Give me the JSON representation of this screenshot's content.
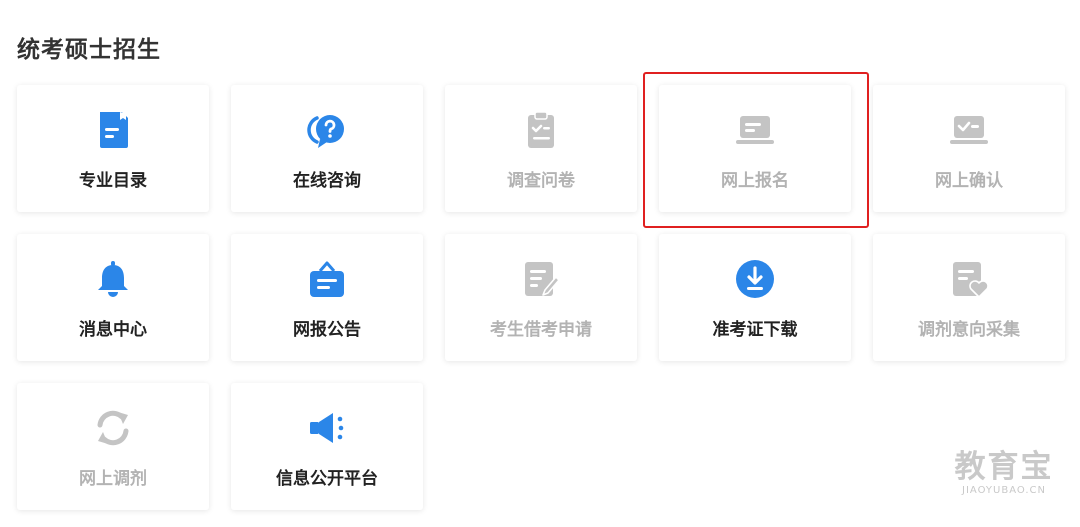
{
  "page": {
    "title": "统考硕士招生"
  },
  "colors": {
    "active": "#2b86e8",
    "disabled": "#c4c4c4",
    "highlight": "#e02020"
  },
  "cards": [
    {
      "label": "专业目录",
      "icon": "catalog-document-icon",
      "state": "active"
    },
    {
      "label": "在线咨询",
      "icon": "chat-question-icon",
      "state": "active"
    },
    {
      "label": "调查问卷",
      "icon": "clipboard-check-icon",
      "state": "disabled"
    },
    {
      "label": "网上报名",
      "icon": "laptop-icon",
      "state": "disabled",
      "highlighted": true
    },
    {
      "label": "网上确认",
      "icon": "laptop-check-icon",
      "state": "disabled"
    },
    {
      "label": "消息中心",
      "icon": "bell-icon",
      "state": "active"
    },
    {
      "label": "网报公告",
      "icon": "announcement-bag-icon",
      "state": "active"
    },
    {
      "label": "考生借考申请",
      "icon": "document-edit-icon",
      "state": "disabled"
    },
    {
      "label": "准考证下载",
      "icon": "download-circle-icon",
      "state": "active"
    },
    {
      "label": "调剂意向采集",
      "icon": "document-heart-icon",
      "state": "disabled"
    },
    {
      "label": "网上调剂",
      "icon": "refresh-arrows-icon",
      "state": "disabled"
    },
    {
      "label": "信息公开平台",
      "icon": "megaphone-icon",
      "state": "active"
    }
  ],
  "watermark": {
    "main": "教育宝",
    "sub": "JIAOYUBAO.CN"
  }
}
